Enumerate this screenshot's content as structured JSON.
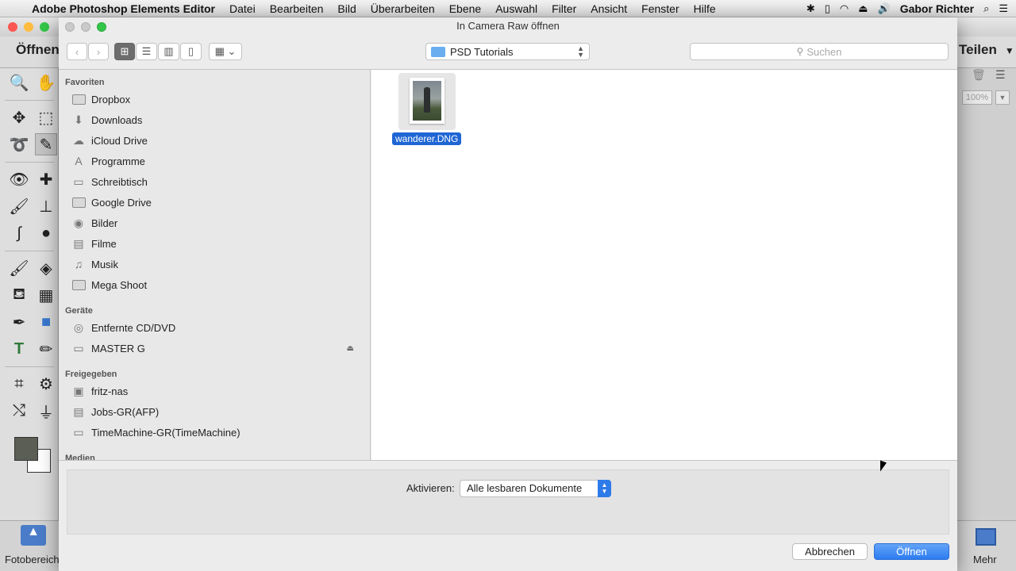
{
  "menubar": {
    "app_name": "Adobe Photoshop Elements Editor",
    "items": [
      "Datei",
      "Bearbeiten",
      "Bild",
      "Überarbeiten",
      "Ebene",
      "Auswahl",
      "Filter",
      "Ansicht",
      "Fenster",
      "Hilfe"
    ],
    "user": "Gabor Richter"
  },
  "background_app": {
    "open_label": "Öffnen",
    "share_label": "Teilen",
    "zoom_value": "100%",
    "photo_area_label": "Fotobereich",
    "more_label": "Mehr"
  },
  "dialog": {
    "title": "In Camera Raw öffnen",
    "path": "PSD Tutorials",
    "search_placeholder": "Suchen",
    "sidebar": {
      "favorites_header": "Favoriten",
      "favorites": [
        "Dropbox",
        "Downloads",
        "iCloud Drive",
        "Programme",
        "Schreibtisch",
        "Google Drive",
        "Bilder",
        "Filme",
        "Musik",
        "Mega Shoot"
      ],
      "devices_header": "Geräte",
      "devices": [
        "Entfernte CD/DVD",
        "MASTER G"
      ],
      "shared_header": "Freigegeben",
      "shared": [
        "fritz-nas",
        "Jobs-GR(AFP)",
        "TimeMachine-GR(TimeMachine)"
      ],
      "media_header": "Medien"
    },
    "file": {
      "name": "wanderer.DNG"
    },
    "activate_label": "Aktivieren:",
    "activate_value": "Alle lesbaren Dokumente",
    "cancel_label": "Abbrechen",
    "open_label": "Öffnen"
  },
  "colors": {
    "accent": "#2c7cf0",
    "selection": "#1f66d4"
  }
}
